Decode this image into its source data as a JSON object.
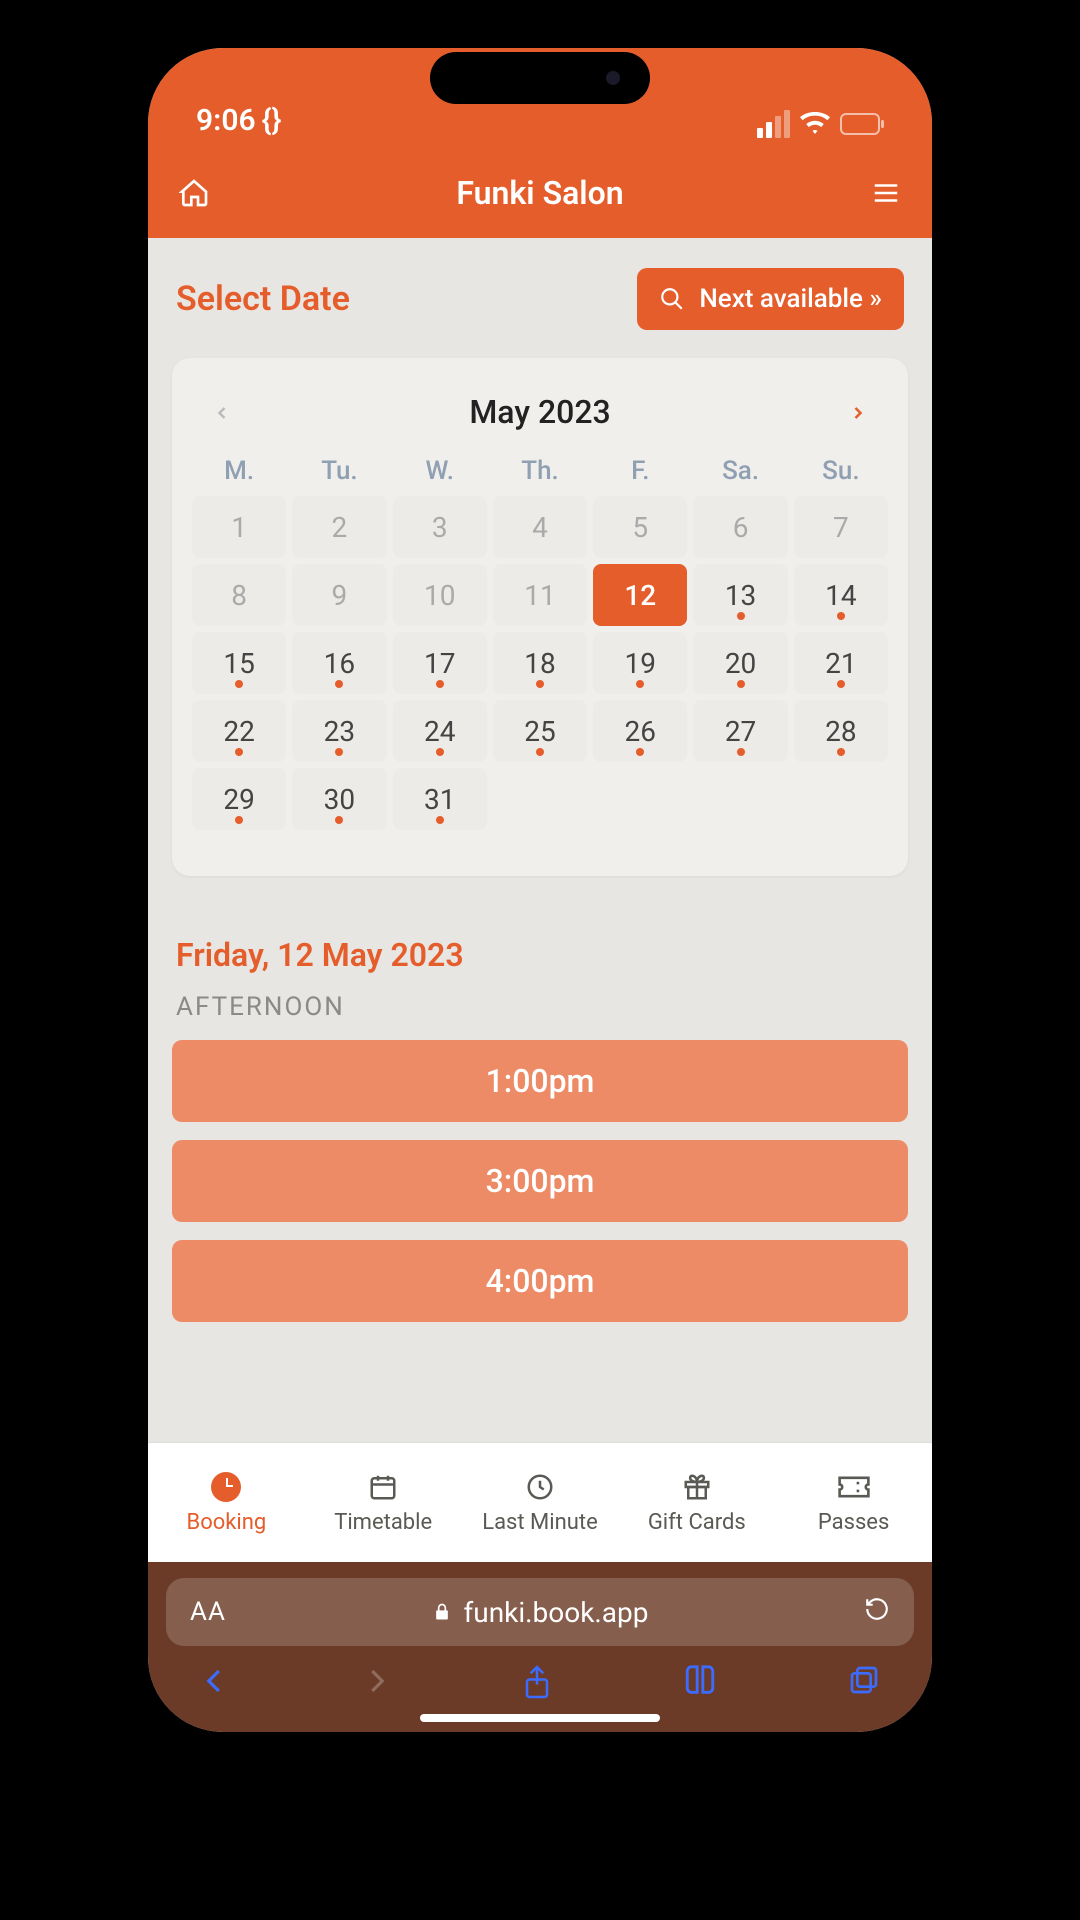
{
  "status": {
    "time": "9:06",
    "extra": "{}"
  },
  "header": {
    "title": "Funki Salon"
  },
  "select": {
    "label": "Select Date",
    "next_available": "Next available »"
  },
  "calendar": {
    "month_label": "May 2023",
    "weekdays": [
      "M.",
      "Tu.",
      "W.",
      "Th.",
      "F.",
      "Sa.",
      "Su."
    ],
    "weeks": [
      [
        {
          "d": "1",
          "muted": true
        },
        {
          "d": "2",
          "muted": true
        },
        {
          "d": "3",
          "muted": true
        },
        {
          "d": "4",
          "muted": true
        },
        {
          "d": "5",
          "muted": true
        },
        {
          "d": "6",
          "muted": true
        },
        {
          "d": "7",
          "muted": true
        }
      ],
      [
        {
          "d": "8",
          "muted": true
        },
        {
          "d": "9",
          "muted": true
        },
        {
          "d": "10",
          "muted": true
        },
        {
          "d": "11",
          "muted": true
        },
        {
          "d": "12",
          "selected": true
        },
        {
          "d": "13",
          "avail": true
        },
        {
          "d": "14",
          "avail": true
        }
      ],
      [
        {
          "d": "15",
          "avail": true
        },
        {
          "d": "16",
          "avail": true
        },
        {
          "d": "17",
          "avail": true
        },
        {
          "d": "18",
          "avail": true
        },
        {
          "d": "19",
          "avail": true
        },
        {
          "d": "20",
          "avail": true
        },
        {
          "d": "21",
          "avail": true
        }
      ],
      [
        {
          "d": "22",
          "avail": true
        },
        {
          "d": "23",
          "avail": true
        },
        {
          "d": "24",
          "avail": true
        },
        {
          "d": "25",
          "avail": true
        },
        {
          "d": "26",
          "avail": true
        },
        {
          "d": "27",
          "avail": true
        },
        {
          "d": "28",
          "avail": true
        }
      ],
      [
        {
          "d": "29",
          "avail": true
        },
        {
          "d": "30",
          "avail": true
        },
        {
          "d": "31",
          "avail": true
        },
        {
          "empty": true
        },
        {
          "empty": true
        },
        {
          "empty": true
        },
        {
          "empty": true
        }
      ]
    ]
  },
  "selected_date_heading": "Friday, 12 May 2023",
  "afternoon": {
    "label": "AFTERNOON",
    "slots": [
      "1:00pm",
      "3:00pm",
      "4:00pm"
    ]
  },
  "tabs": {
    "booking": "Booking",
    "timetable": "Timetable",
    "lastminute": "Last Minute",
    "giftcards": "Gift Cards",
    "passes": "Passes"
  },
  "browser": {
    "url": "funki.book.app"
  }
}
